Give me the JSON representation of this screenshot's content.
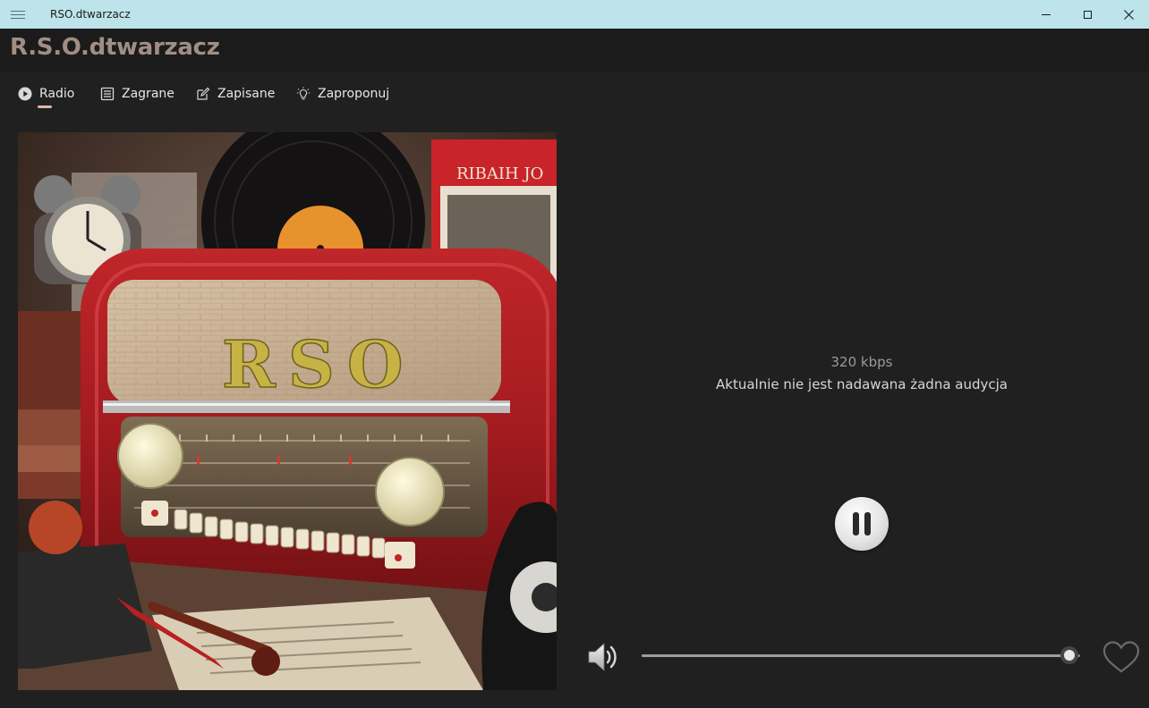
{
  "window": {
    "title": "RSO.dtwarzacz"
  },
  "app": {
    "title": "R.S.O.dtwarzacz"
  },
  "tabs": [
    {
      "label": "Radio",
      "icon": "play-circle-icon",
      "selected": true
    },
    {
      "label": "Zagrane",
      "icon": "list-icon",
      "selected": false
    },
    {
      "label": "Zapisane",
      "icon": "edit-icon",
      "selected": false
    },
    {
      "label": "Zaproponuj",
      "icon": "lightbulb-icon",
      "selected": false
    }
  ],
  "artwork": {
    "text": "RSO"
  },
  "player": {
    "bitrate": "320 kbps",
    "status": "Aktualnie nie jest nadawana żadna audycja",
    "state": "playing",
    "volume_fraction": 0.975,
    "favorite": false
  },
  "colors": {
    "titlebar": "#bde4ea",
    "background": "#202020",
    "app_title": "#a08e84",
    "tab_indicator": "#d9b9a8"
  }
}
